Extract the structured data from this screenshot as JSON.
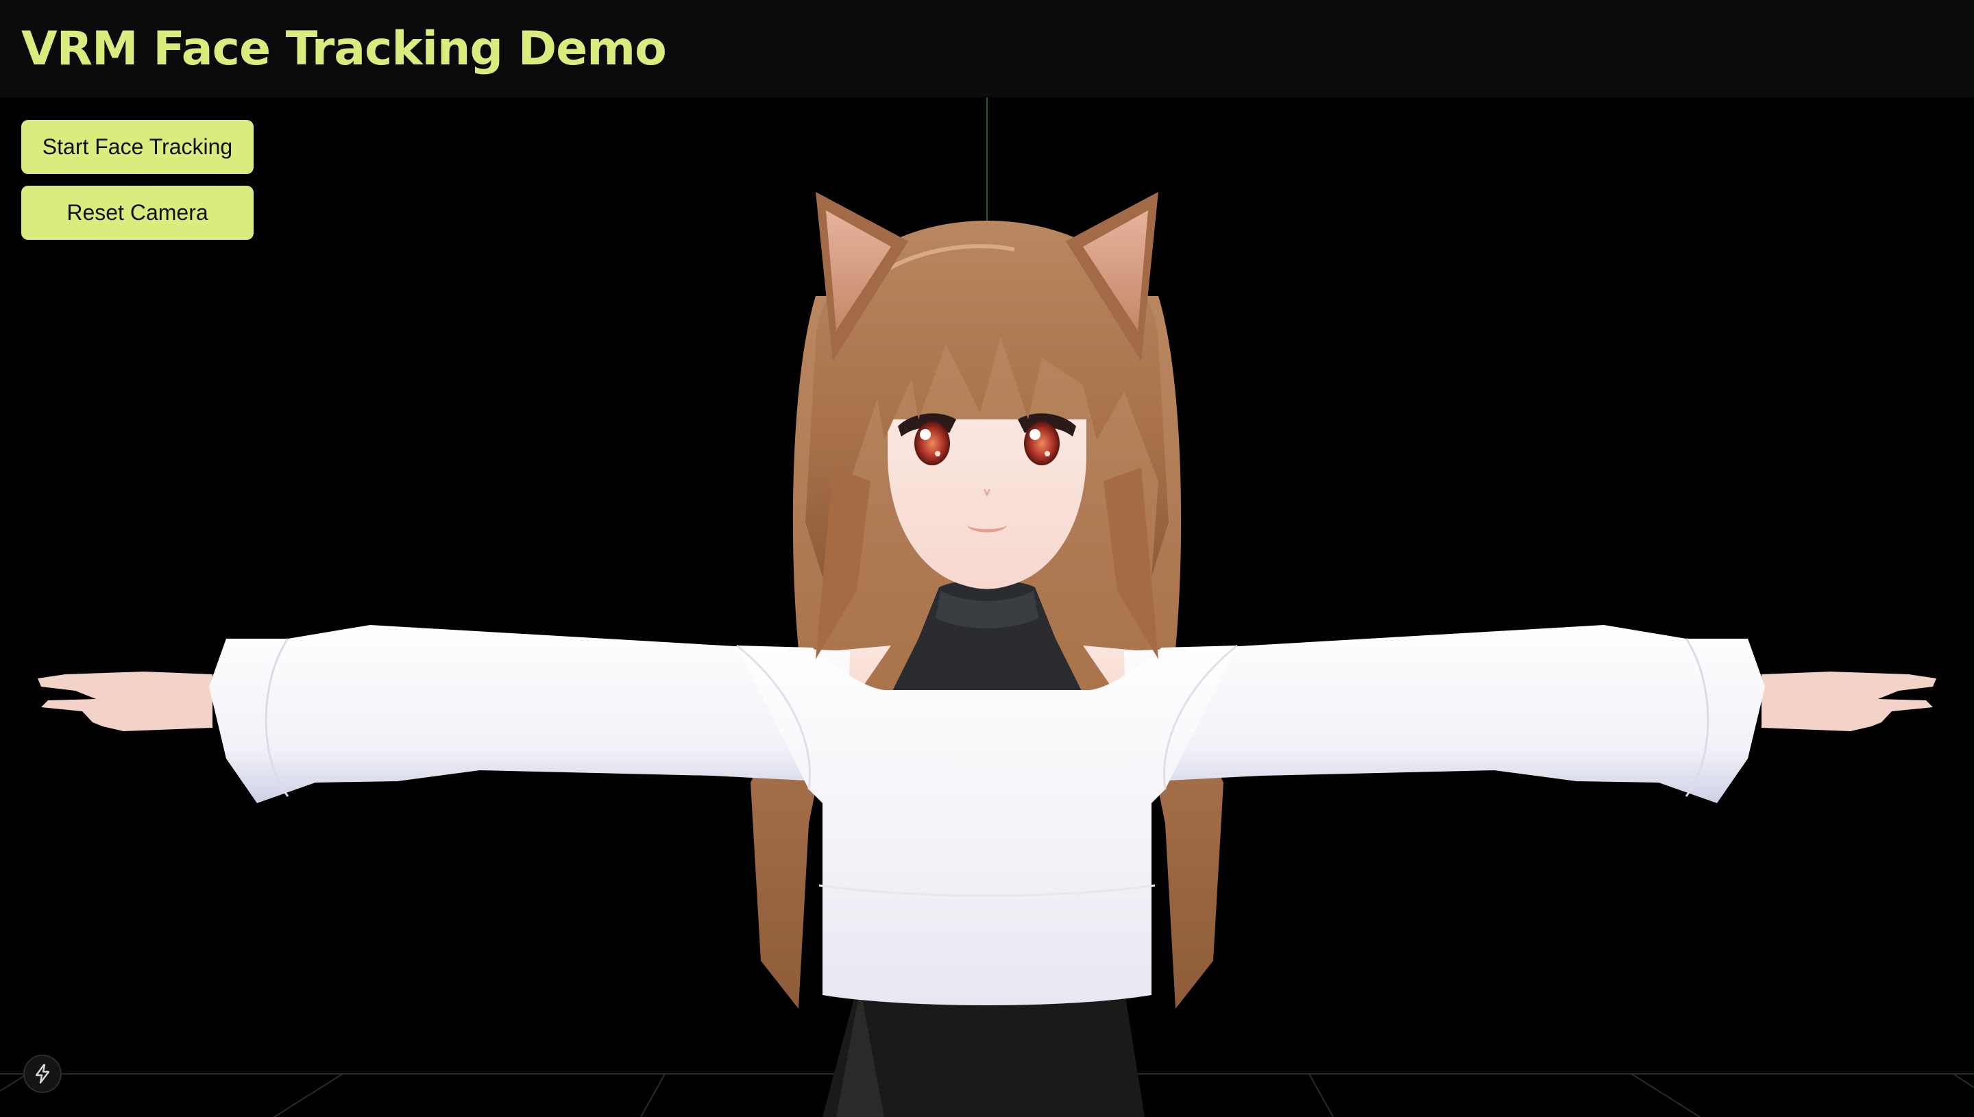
{
  "header": {
    "title": "VRM Face Tracking Demo"
  },
  "controls": {
    "start_label": "Start Face Tracking",
    "reset_label": "Reset Camera"
  },
  "colors": {
    "accent": "#d9ec7e",
    "background": "#000000",
    "header_bg": "#0b0b0b",
    "axis_line": "#1f5a2a"
  },
  "viewport": {
    "model": "vrm-avatar",
    "pose": "t-pose"
  },
  "badge": {
    "icon": "bolt-icon"
  }
}
